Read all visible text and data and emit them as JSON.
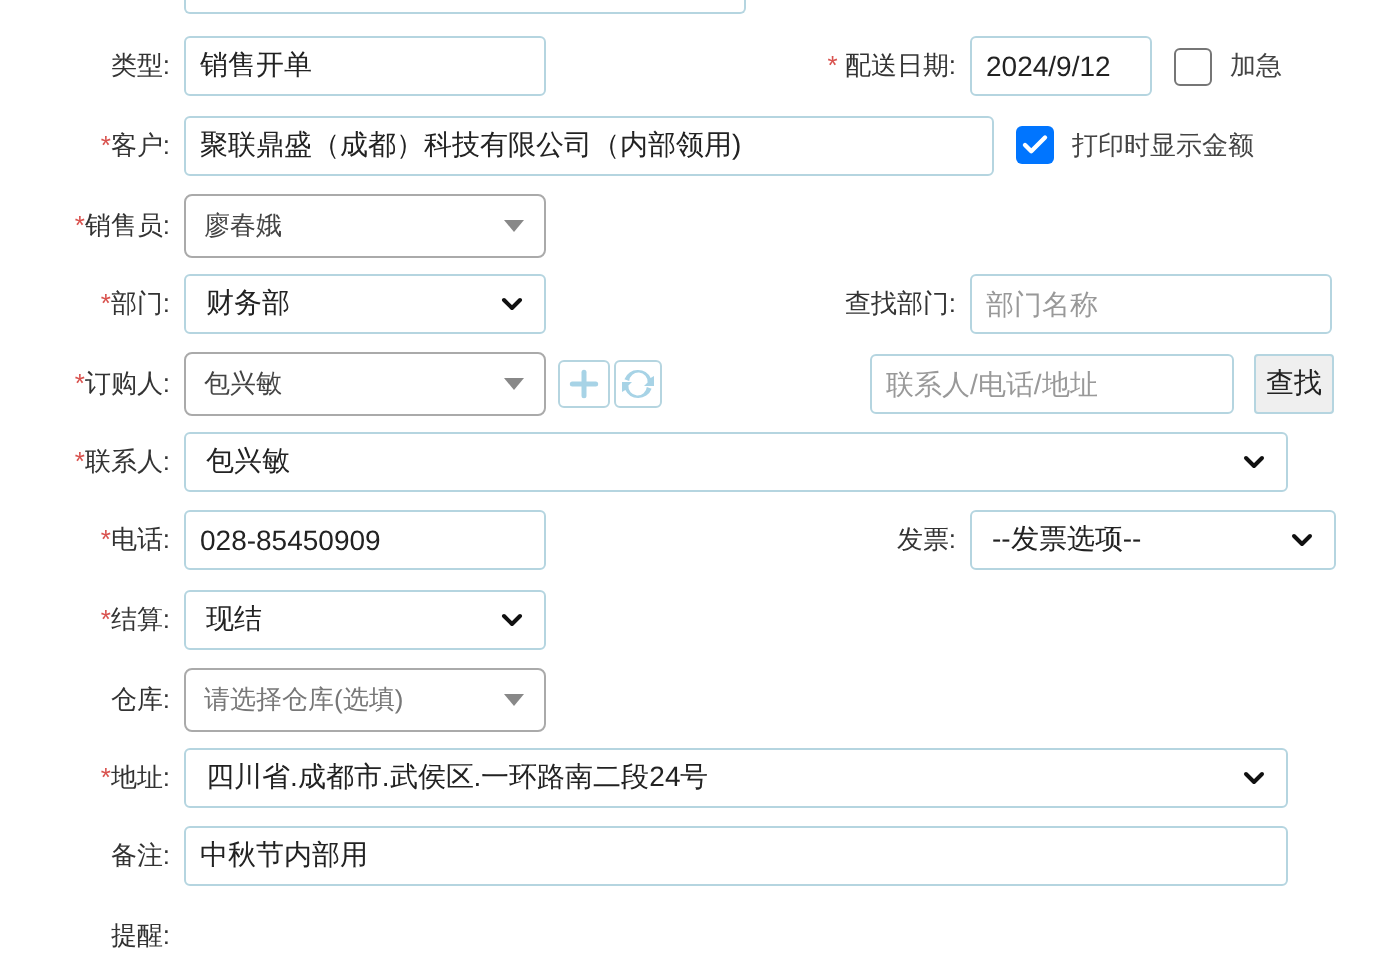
{
  "rows": [
    {
      "label": "类型:",
      "control": {
        "kind": "input",
        "value": "销售开单"
      },
      "side": {
        "mark": "*",
        "label": "配送日期:",
        "control": {
          "kind": "input",
          "value": "2024/9/12"
        },
        "extras": [
          {
            "kind": "checkbox",
            "label": "加急",
            "checked": false
          }
        ]
      }
    },
    {
      "mark": "*",
      "label": "客户:",
      "control": {
        "kind": "input",
        "value": "聚联鼎盛（成都）科技有限公司（内部领用)"
      },
      "extras": [
        {
          "kind": "checkbox",
          "label": "打印时显示金额",
          "checked": true
        }
      ]
    },
    {
      "mark": "*",
      "label": "销售员:",
      "control": {
        "kind": "combo",
        "value": "廖春娥"
      }
    },
    {
      "mark": "*",
      "label": "部门:",
      "control": {
        "kind": "select",
        "value": "财务部"
      },
      "side": {
        "label": "查找部门:",
        "control": {
          "kind": "input",
          "placeholder": "部门名称"
        }
      }
    },
    {
      "mark": "*",
      "label": "订购人:",
      "control": {
        "kind": "combo",
        "value": "包兴敏"
      },
      "extras": [
        {
          "kind": "add"
        },
        {
          "kind": "refresh"
        },
        {
          "kind": "field",
          "placeholder": "联系人/电话/地址"
        },
        {
          "kind": "button",
          "label": "查找"
        }
      ]
    },
    {
      "mark": "*",
      "label": "联系人:",
      "control": {
        "kind": "select",
        "value": "包兴敏"
      }
    },
    {
      "mark": "*",
      "label": "电话:",
      "control": {
        "kind": "input",
        "value": "028-85450909"
      },
      "side": {
        "label": "发票:",
        "control": {
          "kind": "select",
          "value": "--发票选项--"
        }
      }
    },
    {
      "mark": "*",
      "label": "结算:",
      "control": {
        "kind": "select",
        "value": "现结"
      }
    },
    {
      "label": "仓库:",
      "control": {
        "kind": "combo",
        "placeholder": "请选择仓库(选填)"
      }
    },
    {
      "mark": "*",
      "label": "地址:",
      "control": {
        "kind": "select",
        "value": "四川省.成都市.武侯区.一环路南二段24号"
      }
    },
    {
      "label": "备注:",
      "control": {
        "kind": "input",
        "value": "中秋节内部用"
      }
    },
    {
      "label": "提醒:"
    }
  ]
}
